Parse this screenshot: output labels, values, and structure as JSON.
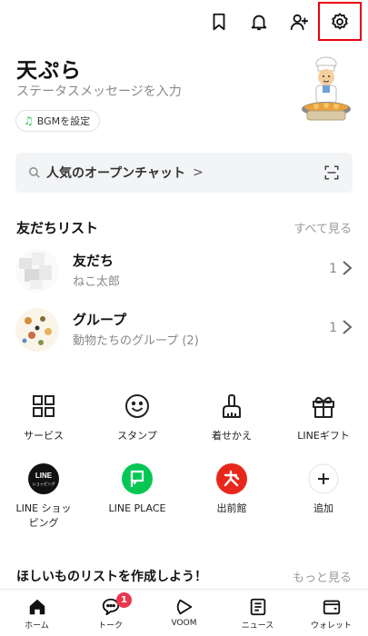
{
  "header": {
    "icons": [
      "bookmark-icon",
      "bell-icon",
      "add-friend-icon",
      "gear-icon"
    ],
    "highlight_color": "#e60012"
  },
  "profile": {
    "name": "天ぷら",
    "status_placeholder": "ステータスメッセージを入力",
    "bgm_label": "BGMを設定"
  },
  "search": {
    "label": "人気のオープンチャット",
    "chevron": ">"
  },
  "friends_list": {
    "title": "友だちリスト",
    "see_all": "すべて見る",
    "rows": [
      {
        "title": "友だち",
        "subtitle": "ねこ太郎",
        "count": "1"
      },
      {
        "title": "グループ",
        "subtitle": "動物たちのグループ (2)",
        "count": "1"
      }
    ]
  },
  "services": [
    {
      "label": "サービス",
      "icon": "grid-icon"
    },
    {
      "label": "スタンプ",
      "icon": "smiley-icon"
    },
    {
      "label": "着せかえ",
      "icon": "brush-icon"
    },
    {
      "label": "LINEギフト",
      "icon": "gift-icon"
    },
    {
      "label": "LINE ショッ\nピング",
      "icon": "line-shopping-icon",
      "badge_text": "LINE",
      "badge_sub": "ショッピング"
    },
    {
      "label": "LINE PLACE",
      "icon": "line-place-icon"
    },
    {
      "label": "出前館",
      "icon": "demaecan-icon"
    },
    {
      "label": "追加",
      "icon": "plus-icon"
    }
  ],
  "wishlist": {
    "title": "ほしいものリストを作成しよう！",
    "more": "もっと見る"
  },
  "tabbar": {
    "tabs": [
      {
        "label": "ホーム",
        "icon": "home-icon"
      },
      {
        "label": "トーク",
        "icon": "chat-icon",
        "badge": "1"
      },
      {
        "label": "VOOM",
        "icon": "voom-icon"
      },
      {
        "label": "ニュース",
        "icon": "news-icon"
      },
      {
        "label": "ウォレット",
        "icon": "wallet-icon"
      }
    ]
  },
  "colors": {
    "line_green": "#06c755",
    "badge_red": "#e8384f",
    "demaecan_red": "#e8271b"
  }
}
